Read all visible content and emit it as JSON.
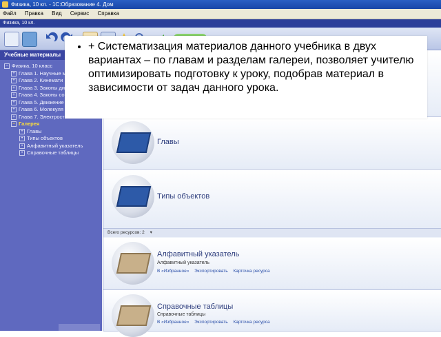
{
  "window": {
    "title": "Физика, 10 кл. - 1С:Образование 4. Дом"
  },
  "menu": {
    "items": [
      "Файл",
      "Правка",
      "Вид",
      "Сервис",
      "Справка"
    ]
  },
  "subbar": {
    "title": "Физика, 10 кл."
  },
  "sidebar": {
    "header": "Учебные материалы",
    "tree": [
      {
        "label": "Физика, 10 класс",
        "level": 0,
        "toggle": "−"
      },
      {
        "label": "Глава 1. Научные м",
        "level": 1,
        "toggle": "+"
      },
      {
        "label": "Глава 2. Кинемати",
        "level": 1,
        "toggle": "+"
      },
      {
        "label": "Глава 3. Законы ди",
        "level": 1,
        "toggle": "+"
      },
      {
        "label": "Глава 4. Законы со",
        "level": 1,
        "toggle": "+"
      },
      {
        "label": "Глава 5. Движение",
        "level": 1,
        "toggle": "+"
      },
      {
        "label": "Глава 6. Молекуля",
        "level": 1,
        "toggle": "+"
      },
      {
        "label": "Глава 7. Электрост",
        "level": 1,
        "toggle": "+"
      },
      {
        "label": "Галерея",
        "level": 1,
        "toggle": "−",
        "selected": true
      },
      {
        "label": "Главы",
        "level": 2,
        "toggle": "+"
      },
      {
        "label": "Типы объектов",
        "level": 2,
        "toggle": "•"
      },
      {
        "label": "Алфавитный указатель",
        "level": 2,
        "toggle": "•"
      },
      {
        "label": "Справочные таблицы",
        "level": 2,
        "toggle": "•"
      }
    ]
  },
  "gallery": {
    "items": [
      {
        "title": "Главы"
      },
      {
        "title": "Типы объектов"
      }
    ],
    "count_label": "Всего ресурсов: 2",
    "resources": [
      {
        "title": "Алфавитный указатель",
        "subtitle": "Алфавитный указатель",
        "links": [
          "В «Избранное»",
          "Экспортировать",
          "Карточка ресурса"
        ]
      },
      {
        "title": "Справочные таблицы",
        "subtitle": "Справочные таблицы",
        "links": [
          "В «Избранное»",
          "Экспортировать",
          "Карточка ресурса"
        ]
      }
    ]
  },
  "callout": {
    "text": "+ Систематизация  материалов данного учебника в двух вариантах – по главам и разделам галереи, позволяет учителю оптимизировать подготовку к уроку, подобрав материал в зависимости от задач данного урока."
  },
  "colors": {
    "sidebar": "#5f69bf",
    "selected": "#ffdf3a",
    "titlebar": "#2a5fc4"
  }
}
